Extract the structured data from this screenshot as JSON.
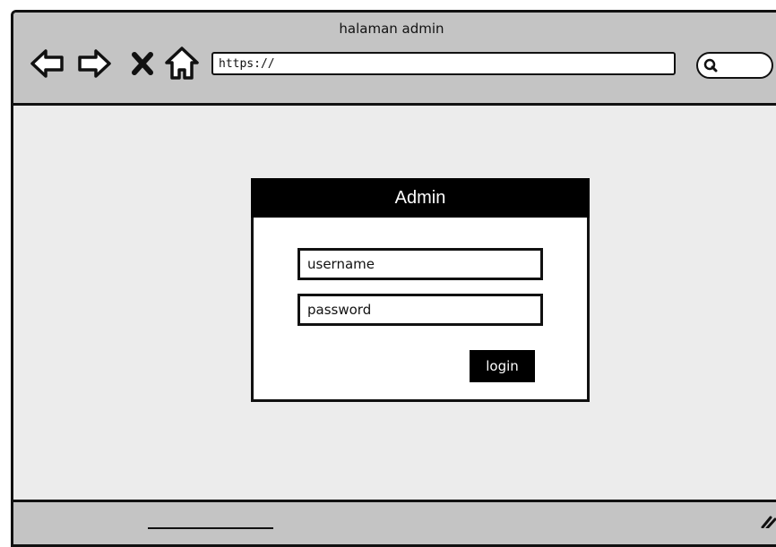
{
  "window": {
    "title": "halaman admin"
  },
  "toolbar": {
    "back_icon": "back-arrow-icon",
    "forward_icon": "forward-arrow-icon",
    "stop_icon": "close-icon",
    "home_icon": "home-icon",
    "url_value": "https://",
    "search_icon": "search-icon"
  },
  "login": {
    "header": "Admin",
    "username_placeholder": "username",
    "password_placeholder": "password",
    "button_label": "login"
  },
  "statusbar": {
    "resize_icon": "resize-grip-icon"
  }
}
